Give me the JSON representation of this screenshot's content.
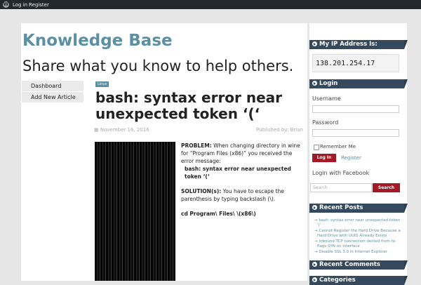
{
  "admin_bar": {
    "wp_logo": "W",
    "login": "Log in",
    "register": "Register"
  },
  "site": {
    "title": "Knowledge Base",
    "tagline": "Share what you know to help others."
  },
  "nav": {
    "items": [
      "Dashboard",
      "Add New Article"
    ]
  },
  "post": {
    "category": "Linux",
    "title": "bash: syntax error near unexpected token ‘(‘",
    "date": "November 16, 2016",
    "published_by": "Published by: Brian",
    "problem_label": "PROBLEM:",
    "problem_text": "When changing directory in wine for “Program Files (x86)” you received the error message:",
    "error_text": "bash: syntax error near unexpected token ‘(‘",
    "solution_label": "SOLUTION(s):",
    "solution_text": "You have to escape the parenthesis by typing backslash (\\).",
    "command": "cd Program\\ Files\\ \\(x86\\)"
  },
  "sidebar": {
    "ip_title": "My IP Address Is:",
    "ip_value": "138.201.254.17",
    "login_title": "Login",
    "username_label": "Username",
    "password_label": "Password",
    "remember_label": "Remember Me",
    "login_button": "Log In",
    "register_link": "Register",
    "facebook_label": "Login with Facebook",
    "search_placeholder": "Search",
    "search_button": "Search",
    "recent_posts_title": "Recent Posts",
    "recent_posts": [
      "bash: syntax error near unexpected token ‘(‘",
      "Cannot Register the Hard Drive Because a Hard Drive with UUID Already Exists",
      "Inbound TCP connection denied from to flags SYN on interface",
      "Disable SSL 3.0 in Internet Explorer"
    ],
    "recent_comments_title": "Recent Comments",
    "categories_title": "Categories"
  },
  "colors": {
    "accent": "#5b8fa3",
    "widget_title_bg": "#34495e",
    "button_red": "#a31824",
    "admin_bar": "#23282d"
  }
}
